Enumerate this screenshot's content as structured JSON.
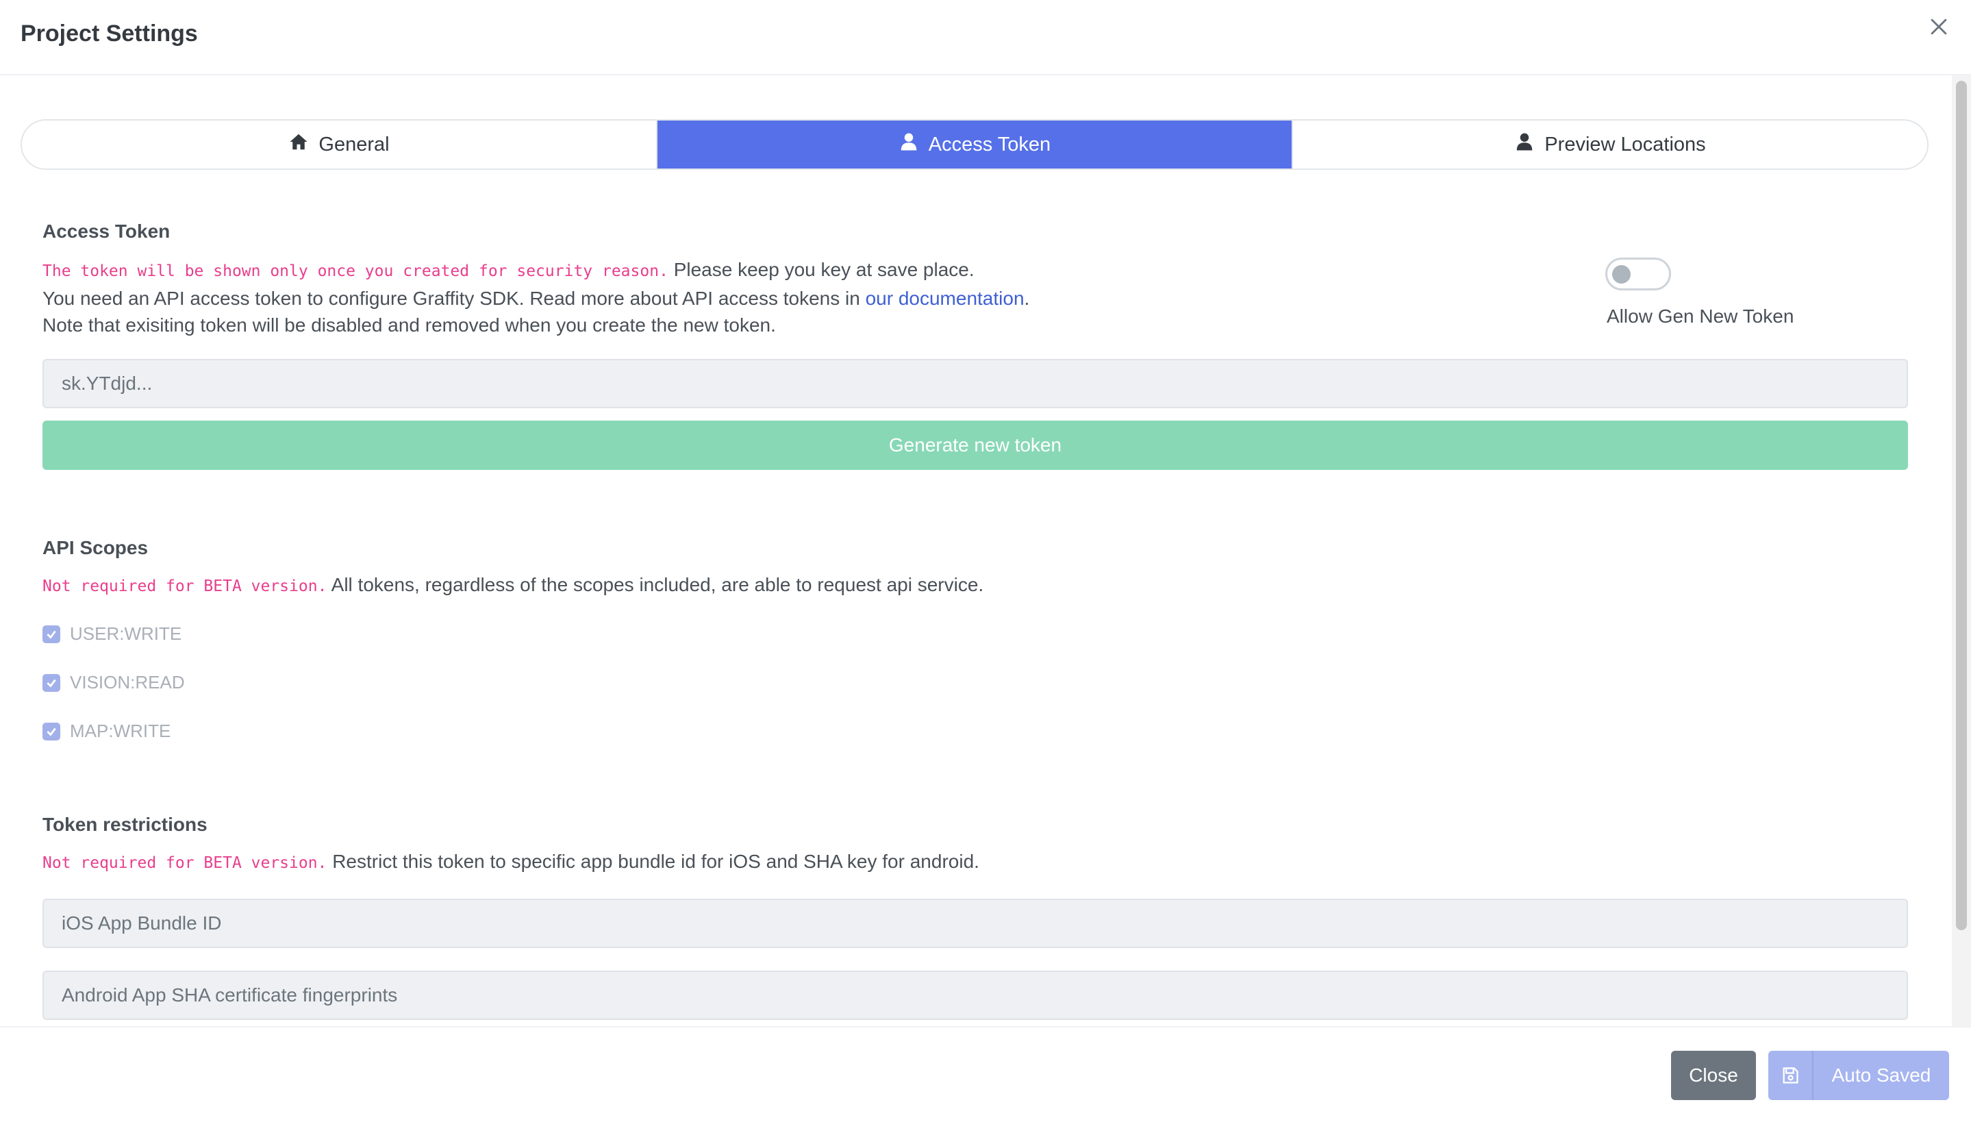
{
  "header": {
    "title": "Project Settings"
  },
  "tabs": [
    {
      "label": "General",
      "icon": "home-icon"
    },
    {
      "label": "Access Token",
      "icon": "user-icon",
      "active": true
    },
    {
      "label": "Preview Locations",
      "icon": "user-icon"
    }
  ],
  "access_token": {
    "title": "Access Token",
    "warning_mono": "The token will be shown only once you created for security reason.",
    "warning_rest": " Please keep you key at save place.",
    "line2_prefix": "You need an API access token to configure Graffity SDK. Read more about API access tokens in ",
    "line2_link": "our documentation",
    "line2_suffix": ".",
    "line3": "Note that exisiting token will be disabled and removed when you create the new token.",
    "token_value": "sk.YTdjd...",
    "generate_label": "Generate new token",
    "toggle_label": "Allow Gen New Token",
    "toggle_on": false
  },
  "api_scopes": {
    "title": "API Scopes",
    "note_mono": "Not required for BETA version.",
    "note_rest": " All tokens, regardless of the scopes included, are able to request api service.",
    "scopes": [
      {
        "label": "USER:WRITE",
        "checked": true
      },
      {
        "label": "VISION:READ",
        "checked": true
      },
      {
        "label": "MAP:WRITE",
        "checked": true
      }
    ]
  },
  "token_restrictions": {
    "title": "Token restrictions",
    "note_mono": "Not required for BETA version.",
    "note_rest": " Restrict this token to specific app bundle id for iOS and SHA key for android.",
    "ios_placeholder": "iOS App Bundle ID",
    "android_placeholder": "Android App SHA certificate fingerprints"
  },
  "footer": {
    "close_label": "Close",
    "save_label": "Auto Saved"
  },
  "colors": {
    "accent": "#5570e8",
    "success": "#88d8b6",
    "danger_text": "#e83e8c",
    "secondary": "#6c757d"
  }
}
